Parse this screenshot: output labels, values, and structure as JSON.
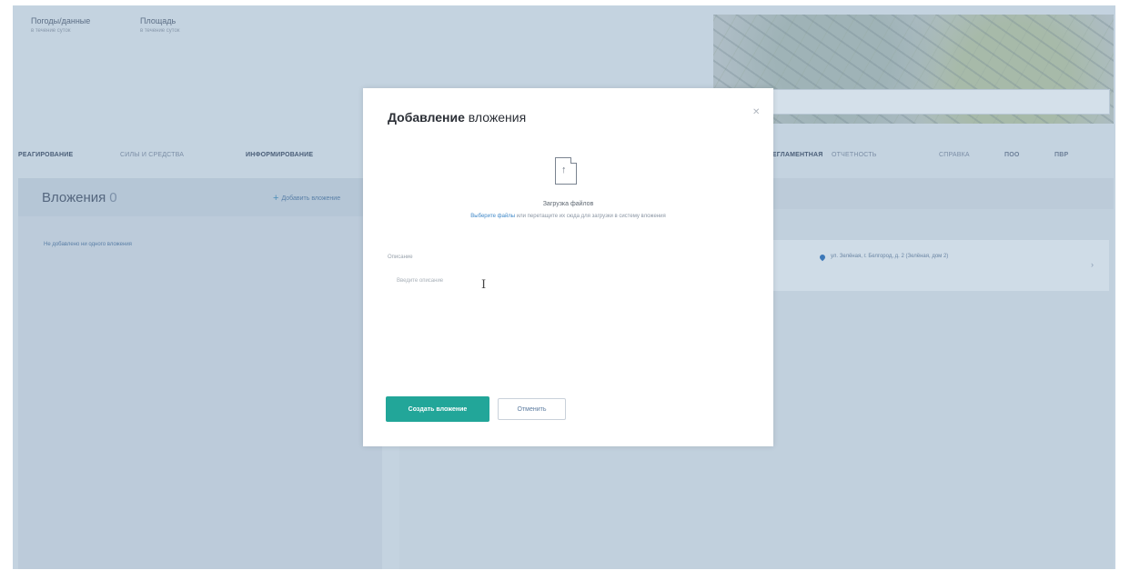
{
  "header": {
    "field1": {
      "label": "Погоды/данные",
      "value": "в течение суток"
    },
    "field2": {
      "label": "Площадь",
      "value": "в течение суток"
    }
  },
  "nav": {
    "items": [
      "РЕАГИРОВАНИЕ",
      "СИЛЫ И СРЕДСТВА",
      "ИНФОРМИРОВАНИЕ"
    ],
    "right_items": [
      "РЕГЛАМЕНТНАЯ",
      "ОТЧЕТНОСТЬ",
      "СПРАВКА",
      "ПОО",
      "ПВР"
    ]
  },
  "attachments": {
    "title": "Вложения",
    "count": "0",
    "add_label": "Добавить вложение",
    "empty_text": "Не добавлено ни одного вложения"
  },
  "right_card": {
    "text": "ул. Зелёная, г. Белгород, д. 2 (Зелёная, дом 2)"
  },
  "modal": {
    "title_bold": "Добавление",
    "title_rest": " вложения",
    "upload_label": "Загрузка файлов",
    "upload_hint_link": "Выберите файлы",
    "upload_hint_rest": " или перетащите их сюда для загрузки в систему вложения",
    "description_label": "Описание",
    "description_placeholder": "Введите описание",
    "create_button": "Создать вложение",
    "cancel_button": "Отменить"
  },
  "icons": {
    "close": "close-icon",
    "upload": "file-upload-icon",
    "add": "plus-icon",
    "location": "location-pin-icon"
  },
  "colors": {
    "accent": "#22a699",
    "link": "#3f88c8",
    "overlay": "#c4d3e0"
  }
}
